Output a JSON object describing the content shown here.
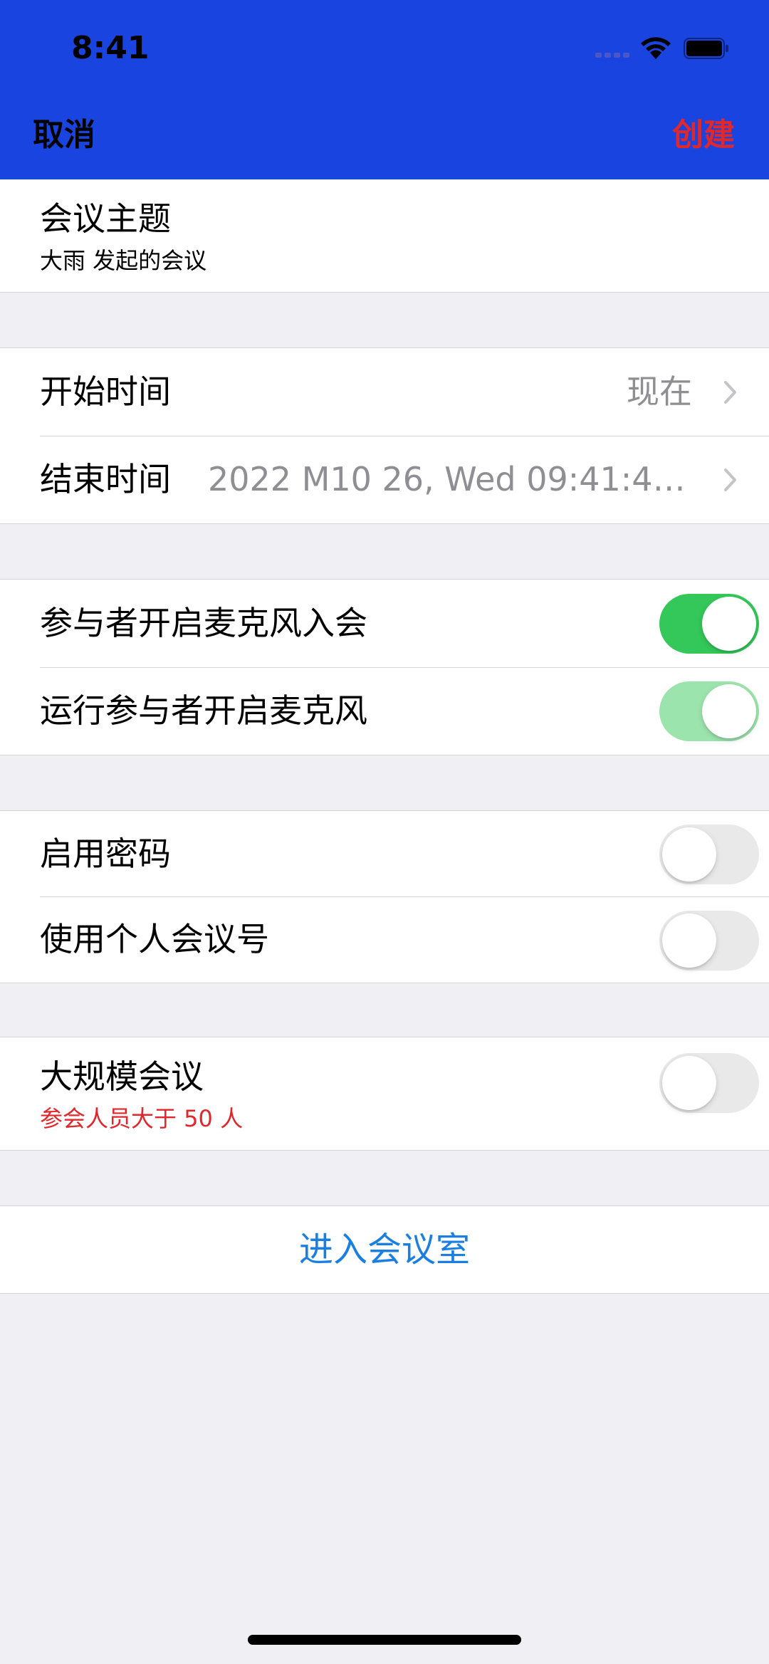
{
  "status_bar": {
    "time": "8:41",
    "wifi_icon": "wifi-icon",
    "battery_icon": "battery-icon"
  },
  "nav": {
    "cancel_label": "取消",
    "create_label": "创建",
    "background_color": "#1a44e0",
    "create_color": "#e0272b"
  },
  "topic": {
    "label": "会议主题",
    "value": "大雨 发起的会议"
  },
  "time_section": {
    "start_label": "开始时间",
    "start_value": "现在",
    "end_label": "结束时间",
    "end_value": "2022 M10 26, Wed 09:41:45 G..."
  },
  "mic_section": {
    "join_with_mic_label": "参与者开启麦克风入会",
    "join_with_mic_on": true,
    "allow_mic_label": "运行参与者开启麦克风",
    "allow_mic_on": true
  },
  "password_section": {
    "password_label": "启用密码",
    "password_on": false,
    "personal_id_label": "使用个人会议号",
    "personal_id_on": false
  },
  "large_meeting": {
    "label": "大规模会议",
    "sub_label": "参会人员大于 50 人",
    "on": false
  },
  "enter_room": {
    "label": "进入会议室",
    "color": "#1a7fe0"
  }
}
